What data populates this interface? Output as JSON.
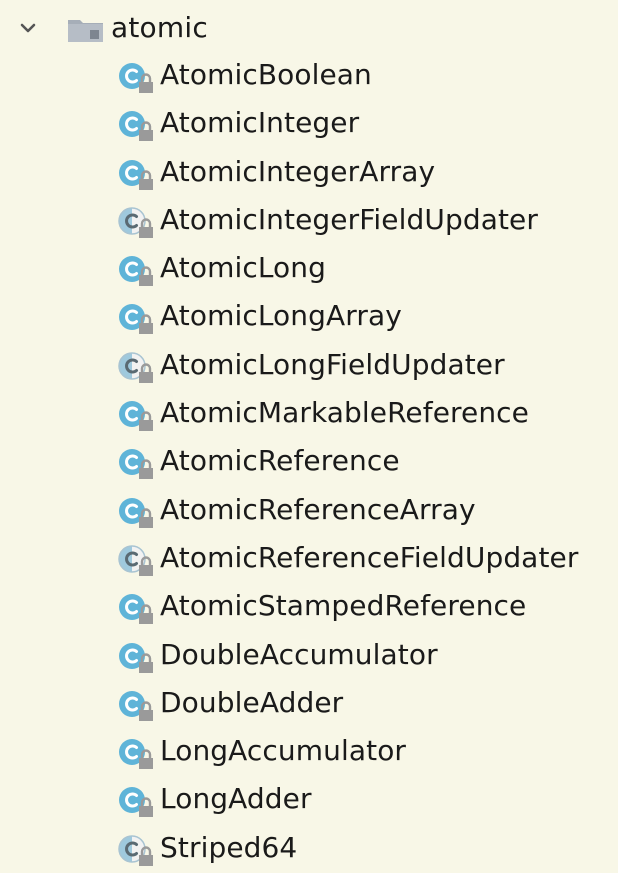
{
  "tree": {
    "folder": {
      "label": "atomic",
      "expanded": true,
      "icon": "package-folder-icon"
    },
    "items": [
      {
        "label": "AtomicBoolean",
        "kind": "class"
      },
      {
        "label": "AtomicInteger",
        "kind": "class"
      },
      {
        "label": "AtomicIntegerArray",
        "kind": "class"
      },
      {
        "label": "AtomicIntegerFieldUpdater",
        "kind": "abstract-class"
      },
      {
        "label": "AtomicLong",
        "kind": "class"
      },
      {
        "label": "AtomicLongArray",
        "kind": "class"
      },
      {
        "label": "AtomicLongFieldUpdater",
        "kind": "abstract-class"
      },
      {
        "label": "AtomicMarkableReference",
        "kind": "class"
      },
      {
        "label": "AtomicReference",
        "kind": "class"
      },
      {
        "label": "AtomicReferenceArray",
        "kind": "class"
      },
      {
        "label": "AtomicReferenceFieldUpdater",
        "kind": "abstract-class"
      },
      {
        "label": "AtomicStampedReference",
        "kind": "class"
      },
      {
        "label": "DoubleAccumulator",
        "kind": "class"
      },
      {
        "label": "DoubleAdder",
        "kind": "class"
      },
      {
        "label": "LongAccumulator",
        "kind": "class"
      },
      {
        "label": "LongAdder",
        "kind": "class"
      },
      {
        "label": "Striped64",
        "kind": "abstract-class"
      }
    ]
  },
  "colors": {
    "background": "#f8f7e7",
    "class_icon": "#5fb4d8",
    "lock_badge": "#9a9a9a",
    "folder": "#a6aeb8"
  }
}
